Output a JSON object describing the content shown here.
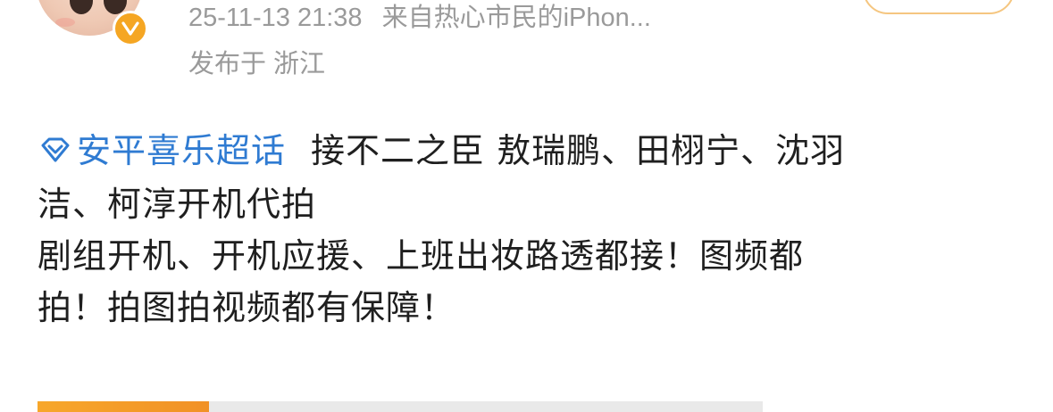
{
  "post": {
    "timestamp": "25-11-13 21:38",
    "source": "来自热心市民的iPhon...",
    "location": "发布于 浙江",
    "topic": "安平喜乐超话",
    "text_line1": "接不二之臣 敖瑞鹏、田栩宁、沈羽",
    "text_line2": "洁、柯淳开机代拍",
    "text_line3": "剧组开机、开机应援、上班出妆路透都接！图频都",
    "text_line4": "拍！拍图拍视频都有保障！"
  },
  "icons": {
    "avatar": "user-avatar",
    "verified": "verified-badge-icon",
    "topic": "diamond-topic-icon"
  },
  "colors": {
    "topic_link": "#2f7bd2",
    "meta_text": "#9a9a9a",
    "body_text": "#1f1f1f",
    "verified_badge": "#f5a623",
    "follow_border": "#f5c680"
  }
}
